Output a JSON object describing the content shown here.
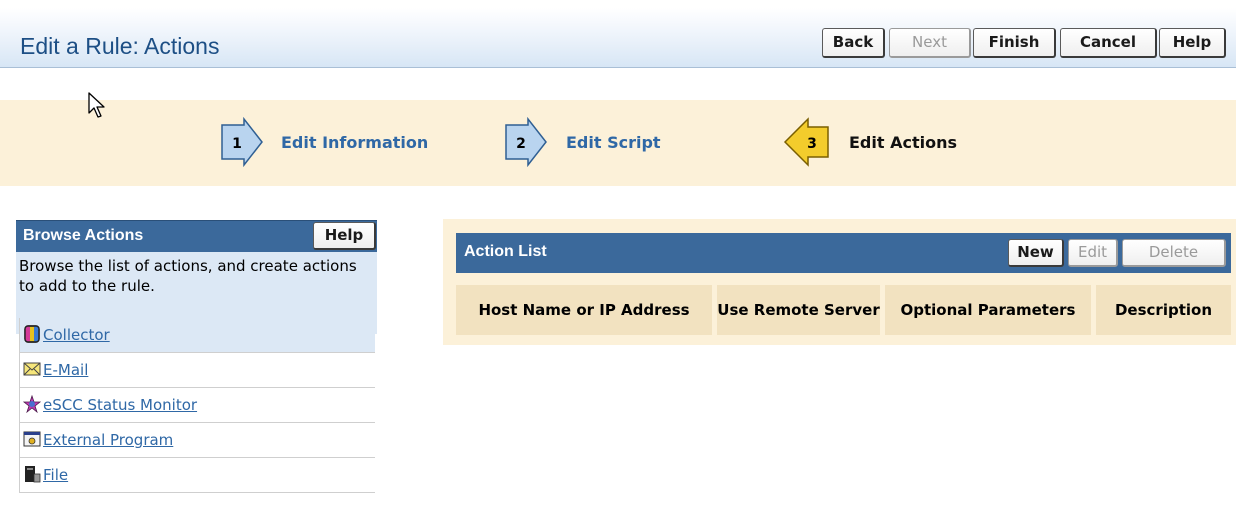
{
  "header": {
    "title": "Edit a Rule: Actions",
    "buttons": {
      "back": "Back",
      "next": "Next",
      "finish": "Finish",
      "cancel": "Cancel",
      "help": "Help"
    }
  },
  "steps": [
    {
      "number": "1",
      "label": "Edit Information",
      "state": "link"
    },
    {
      "number": "2",
      "label": "Edit Script",
      "state": "link"
    },
    {
      "number": "3",
      "label": "Edit Actions",
      "state": "current"
    }
  ],
  "browse_actions": {
    "title": "Browse Actions",
    "help_label": "Help",
    "description": "Browse the list of actions, and create actions to add to the rule.",
    "items": [
      {
        "label": "Collector",
        "icon": "collector-icon",
        "selected": true
      },
      {
        "label": "E-Mail",
        "icon": "envelope-icon",
        "selected": false
      },
      {
        "label": "eSCC Status Monitor",
        "icon": "status-monitor-icon",
        "selected": false
      },
      {
        "label": "External Program",
        "icon": "program-window-icon",
        "selected": false
      },
      {
        "label": "File",
        "icon": "file-icon",
        "selected": false
      }
    ]
  },
  "action_list": {
    "title": "Action List",
    "buttons": {
      "new": "New",
      "edit": "Edit",
      "delete": "Delete"
    },
    "columns": [
      "Host Name or IP Address",
      "Use Remote Server",
      "Optional Parameters",
      "Description"
    ]
  },
  "colors": {
    "panel_header": "#3b699b",
    "link": "#2f68a6",
    "step_arrow": "#b9d4ef",
    "current_step_arrow": "#f3cc2c",
    "band": "#fcf1d9"
  }
}
